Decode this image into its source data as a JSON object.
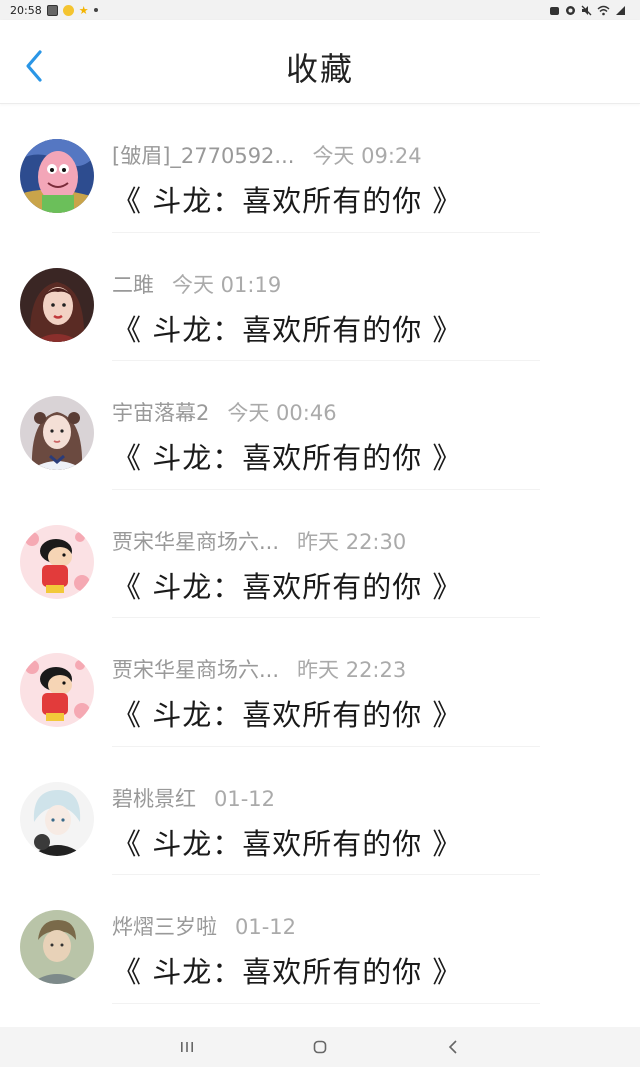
{
  "status_bar": {
    "time": "20:58"
  },
  "header": {
    "title": "收藏"
  },
  "colors": {
    "accent": "#2a96e6"
  },
  "items": [
    {
      "user": "[皱眉]_2770592...",
      "time": "今天 09:24",
      "title": "《 斗龙：喜欢所有的你 》",
      "avatar": "patrick-avatar"
    },
    {
      "user": "二雎",
      "time": "今天 01:19",
      "title": "《 斗龙：喜欢所有的你 》",
      "avatar": "girl-red-avatar"
    },
    {
      "user": "宇宙落幕2",
      "time": "今天 00:46",
      "title": "《 斗龙：喜欢所有的你 》",
      "avatar": "girl-photo-avatar"
    },
    {
      "user": "贾宋华星商场六...",
      "time": "昨天 22:30",
      "title": "《 斗龙：喜欢所有的你 》",
      "avatar": "crayon-shin-chan-avatar"
    },
    {
      "user": "贾宋华星商场六...",
      "time": "昨天 22:23",
      "title": "《 斗龙：喜欢所有的你 》",
      "avatar": "crayon-shin-chan-avatar"
    },
    {
      "user": "碧桃景红",
      "time": "01-12",
      "title": "《 斗龙：喜欢所有的你 》",
      "avatar": "anime-boy-avatar"
    },
    {
      "user": "烨熠三岁啦",
      "time": "01-12",
      "title": "《 斗龙：喜欢所有的你 》",
      "avatar": "boy-photo-avatar"
    }
  ]
}
